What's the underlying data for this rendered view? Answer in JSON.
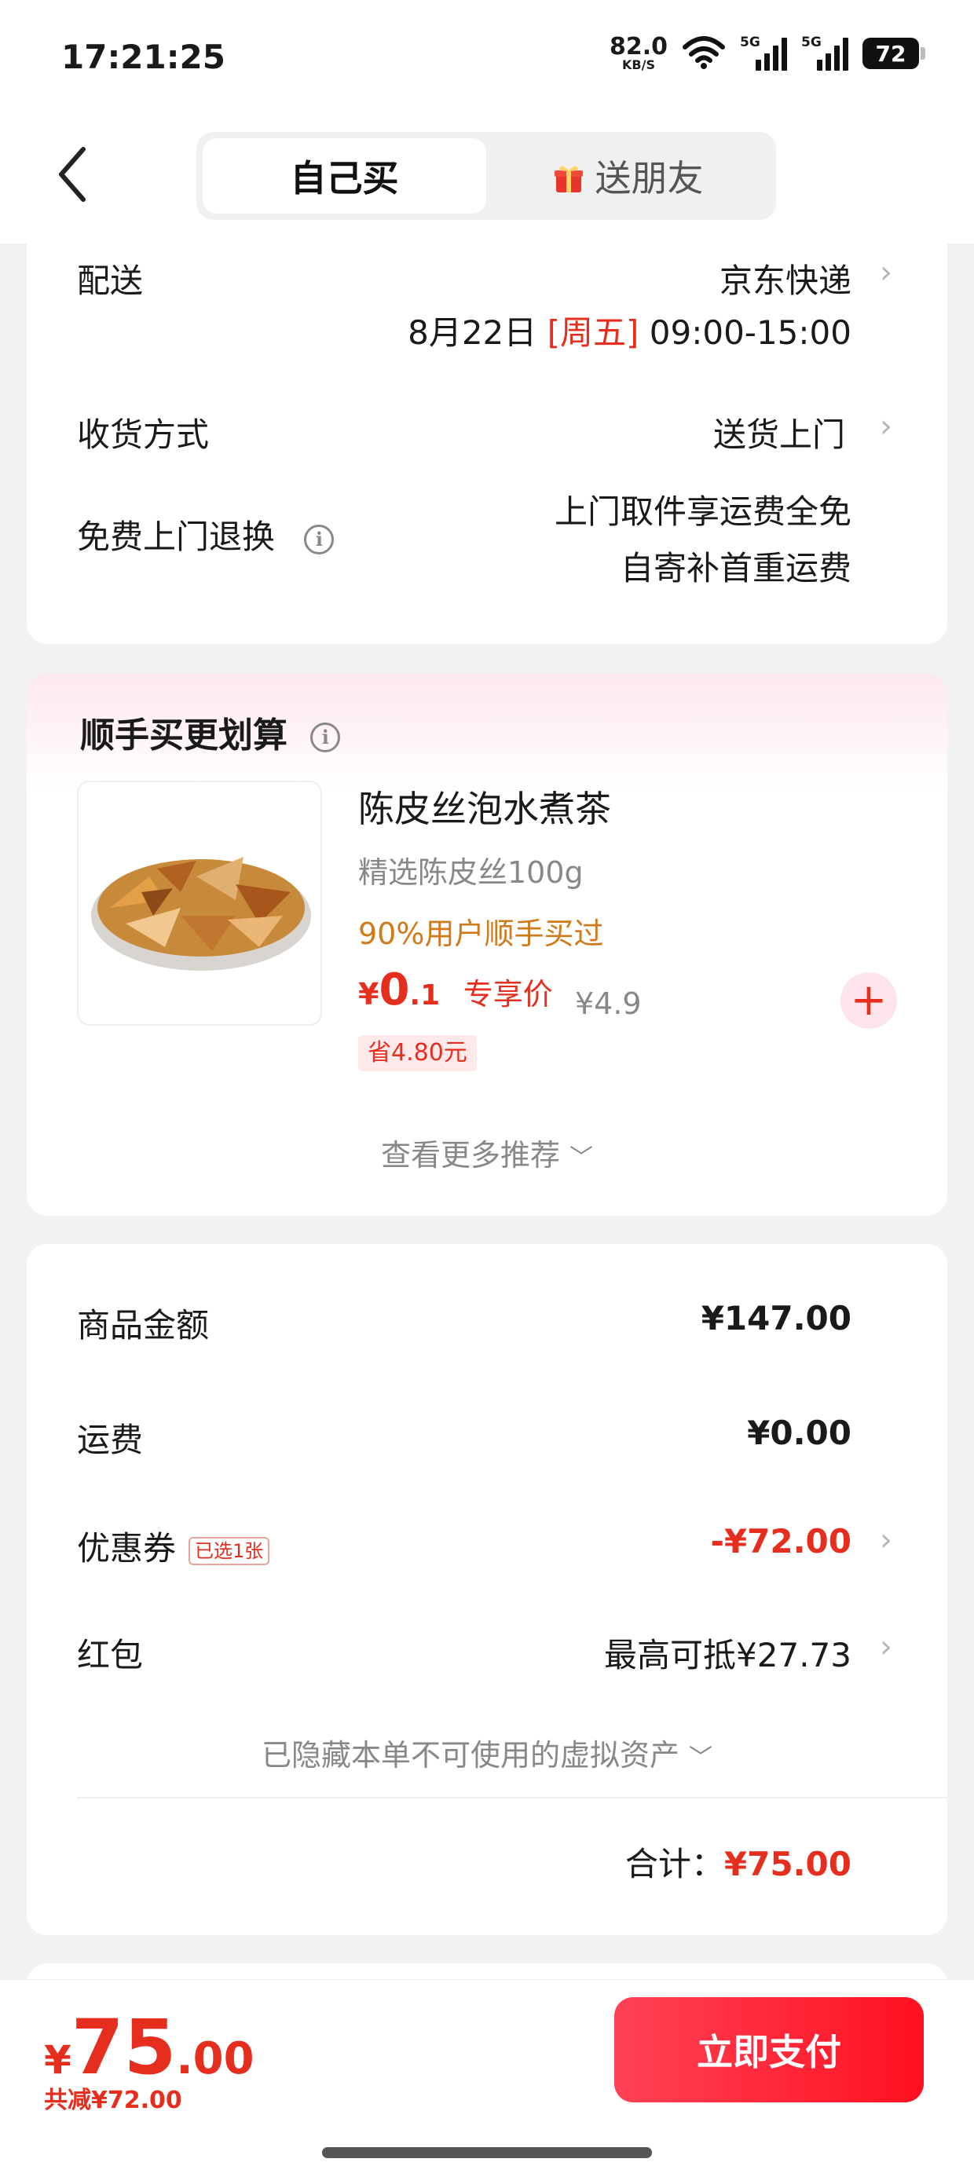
{
  "status_bar": {
    "time": "17:21:25",
    "net_speed": "82.0",
    "net_unit": "KB/S",
    "signal1_label": "5G",
    "signal2_label": "5G",
    "battery": "72"
  },
  "header": {
    "tab_self": "自己买",
    "tab_gift": "送朋友"
  },
  "delivery": {
    "label": "配送",
    "carrier": "京东快递",
    "date": "8月22日",
    "weekday": "[周五]",
    "time_window": "09:00-15:00",
    "receive_label": "收货方式",
    "receive_value": "送货上门",
    "return_label": "免费上门退换",
    "return_line1": "上门取件享运费全免",
    "return_line2": "自寄补首重运费"
  },
  "addon": {
    "title": "顺手买更划算",
    "product_name": "陈皮丝泡水煮茶",
    "product_spec": "精选陈皮丝100g",
    "product_hint": "90%用户顺手买过",
    "price_symbol": "¥",
    "price_int": "0",
    "price_dec": ".1",
    "price_label": "专享价",
    "original_price": "¥4.9",
    "save_badge": "省4.80元",
    "more_label": "查看更多推荐"
  },
  "summary": {
    "goods_label": "商品金额",
    "goods_value": "¥147.00",
    "shipping_label": "运费",
    "shipping_value": "¥0.00",
    "coupon_label": "优惠券",
    "coupon_tag": "已选1张",
    "coupon_value": "-¥72.00",
    "redpacket_label": "红包",
    "redpacket_value": "最高可抵¥27.73",
    "hidden_assets": "已隐藏本单不可使用的虚拟资产",
    "total_label": "合计：",
    "total_value": "¥75.00"
  },
  "bottom": {
    "currency": "¥",
    "amount_int": "75",
    "amount_dec": ".00",
    "saved": "共减¥72.00",
    "pay_button": "立即支付"
  },
  "colors": {
    "accent_red": "#e62e1f",
    "hint_orange": "#d07a1a"
  }
}
